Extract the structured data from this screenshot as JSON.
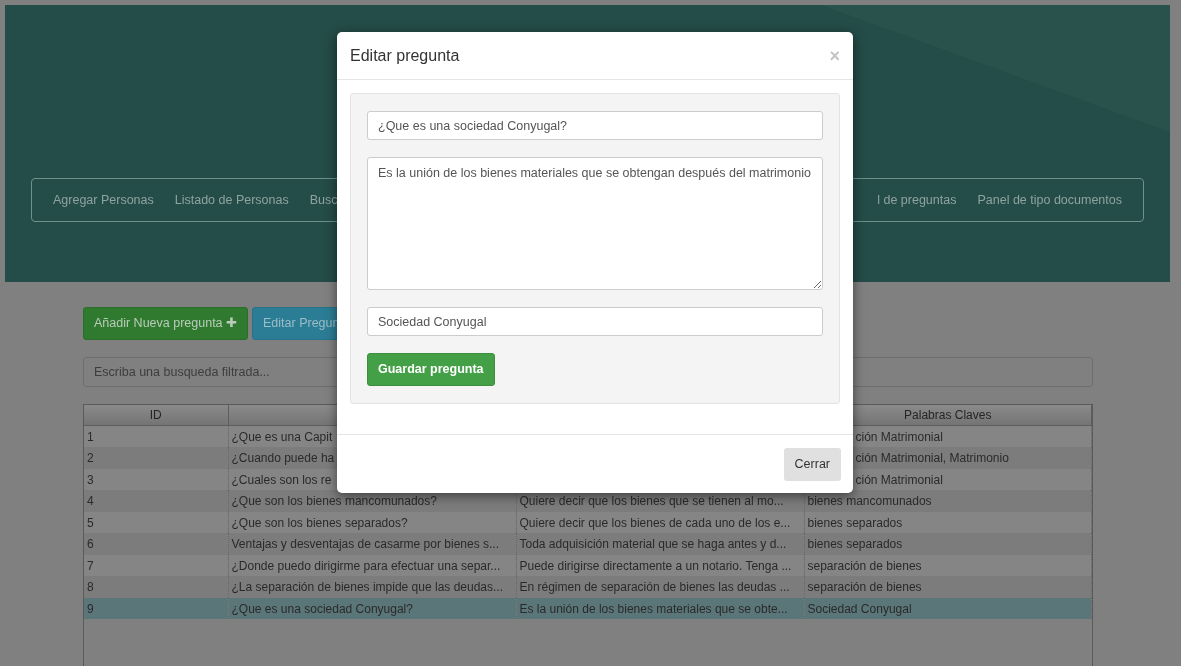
{
  "nav": {
    "left_items": [
      "Agregar Personas",
      "Listado de Personas",
      "Busc"
    ],
    "right_items": [
      "l de preguntas",
      "Panel de tipo documentos"
    ]
  },
  "toolbar": {
    "add_button": "Añadir Nueva pregunta",
    "add_icon": "✚",
    "edit_button": "Editar Pregun"
  },
  "search": {
    "placeholder": "Escriba una busqueda filtrada..."
  },
  "table": {
    "columns": [
      "ID",
      "",
      "",
      "Palabras Claves"
    ],
    "rows": [
      {
        "cells": [
          "1",
          "¿Que es una Capit",
          "",
          "ción Matrimonial"
        ],
        "covered": true,
        "selected": false
      },
      {
        "cells": [
          "2",
          "¿Cuando puede ha",
          "",
          "ción Matrimonial, Matrimonio"
        ],
        "covered": true,
        "selected": false
      },
      {
        "cells": [
          "3",
          "¿Cuales son los re",
          "",
          "ción Matrimonial"
        ],
        "covered": true,
        "selected": false
      },
      {
        "cells": [
          "4",
          "¿Que son los bienes mancomunados?",
          "Quiere decir que los bienes que se tienen al mo...",
          "bienes mancomunados"
        ],
        "covered": false,
        "selected": false
      },
      {
        "cells": [
          "5",
          "¿Que son los bienes separados?",
          "Quiere decir que los bienes de cada uno de los e...",
          "bienes separados"
        ],
        "covered": false,
        "selected": false
      },
      {
        "cells": [
          "6",
          "Ventajas y desventajas de casarme por bienes s...",
          "Toda adquisición material que se haga antes y d...",
          "bienes separados"
        ],
        "covered": false,
        "selected": false
      },
      {
        "cells": [
          "7",
          "¿Donde puedo dirigirme para efectuar una separ...",
          "Puede dirigirse directamente a un notario. Tenga ...",
          "separación de bienes"
        ],
        "covered": false,
        "selected": false
      },
      {
        "cells": [
          "8",
          "¿La separación de bienes impide que las deudas...",
          "En régimen de separación de bienes las deudas ...",
          "separación de bienes"
        ],
        "covered": false,
        "selected": false
      },
      {
        "cells": [
          "9",
          "¿Que es una sociedad Conyugal?",
          "Es la unión de los bienes materiales que se obte...",
          "Sociedad Conyugal"
        ],
        "covered": false,
        "selected": true
      }
    ]
  },
  "modal": {
    "title": "Editar pregunta",
    "close": "×",
    "question": "¿Que es una sociedad Conyugal?",
    "answer": "Es la unión de los bienes materiales que se obtengan después del matrimonio",
    "keywords": "Sociedad Conyugal",
    "save_button": "Guardar pregunta",
    "close_button": "Cerrar"
  }
}
